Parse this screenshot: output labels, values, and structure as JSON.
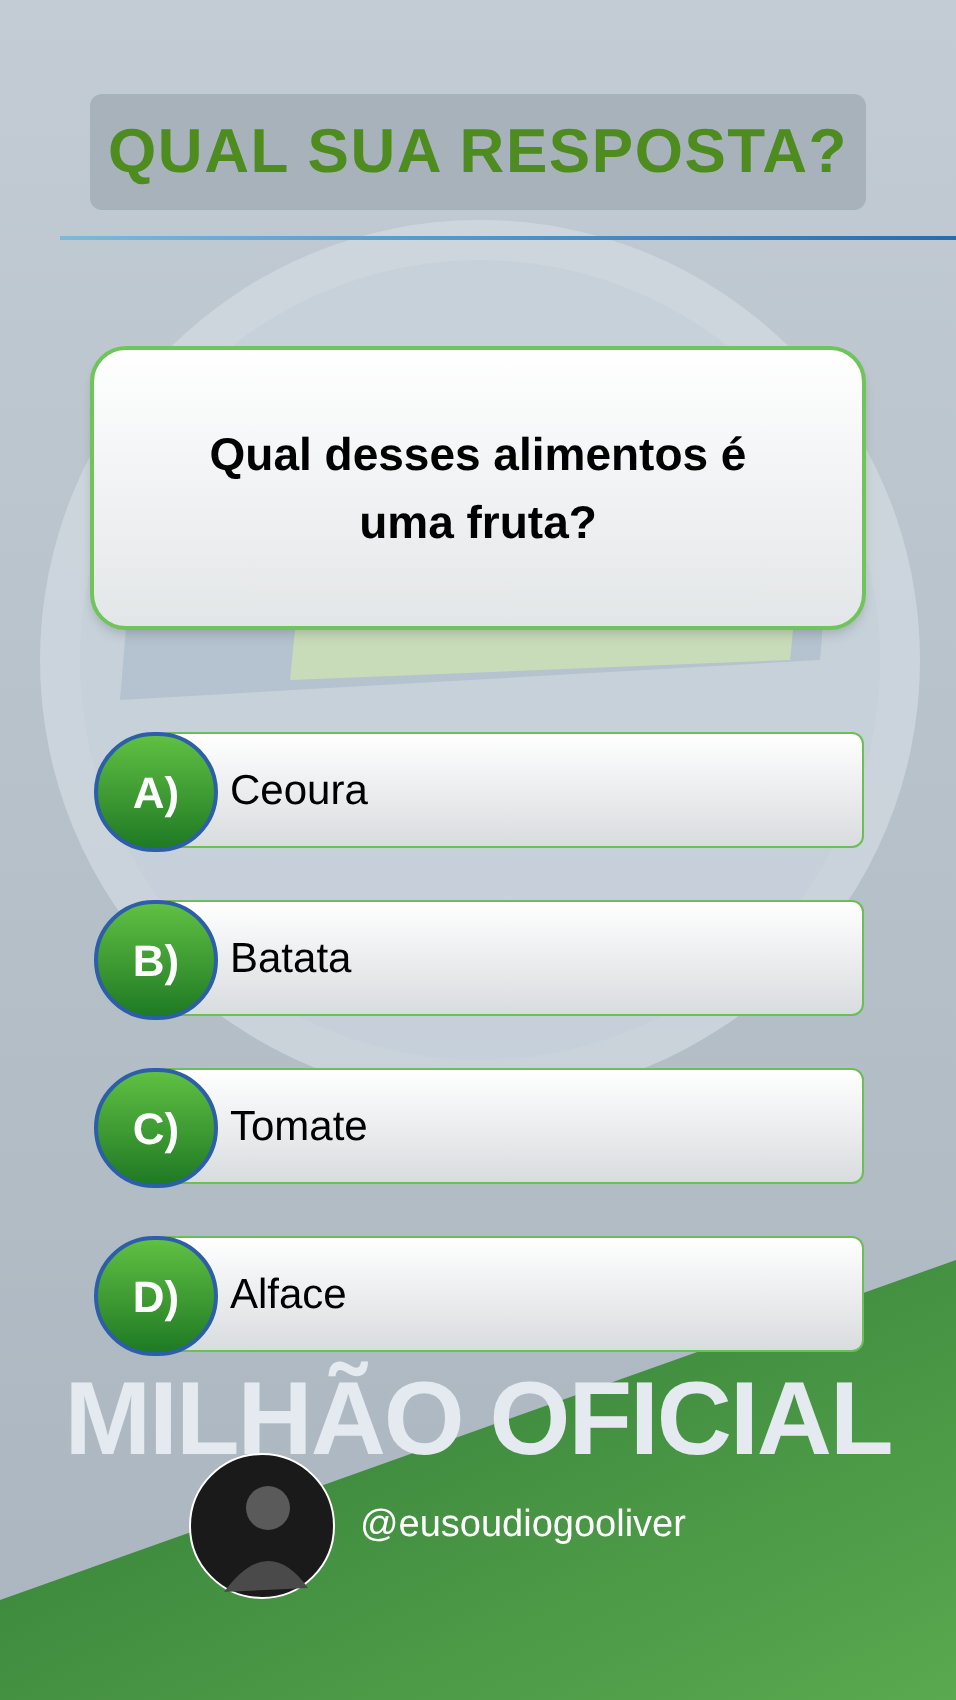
{
  "header": {
    "title": "QUAL SUA RESPOSTA?"
  },
  "question": {
    "text": "Qual desses alimentos é uma fruta?"
  },
  "options": [
    {
      "letter": "A)",
      "text": "Ceoura"
    },
    {
      "letter": "B)",
      "text": "Batata"
    },
    {
      "letter": "C)",
      "text": "Tomate"
    },
    {
      "letter": "D)",
      "text": "Alface"
    }
  ],
  "background": {
    "title": "MILHÃO OFICIAL"
  },
  "profile": {
    "handle": "@eusoudiogooliver"
  }
}
